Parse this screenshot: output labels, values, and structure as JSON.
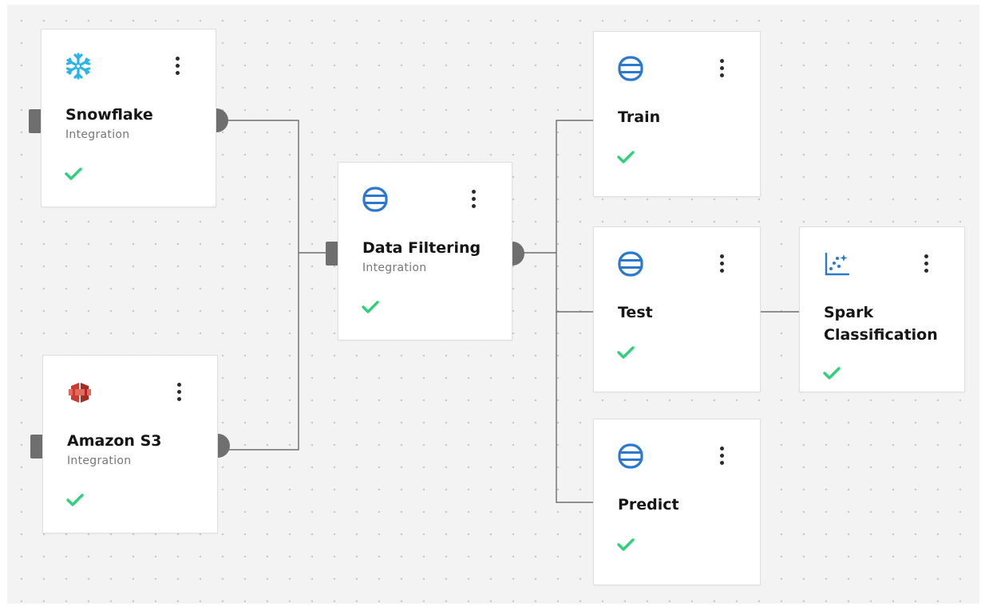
{
  "colors": {
    "canvas_background": "#f3f3f3",
    "grid_dot": "#c6c6c6",
    "edge": "#6f6f6f",
    "port": "#6f6f6f",
    "check": "#2ed17a",
    "database_icon": "#2b78d0",
    "snowflake_icon": "#29b5e8",
    "s3_icon": "#d0392f",
    "chart_icon": "#2b78d0"
  },
  "nodes": {
    "snowflake": {
      "title": "Snowflake",
      "subtitle": "Integration",
      "icon": "snowflake-icon",
      "status": "success"
    },
    "amazon_s3": {
      "title": "Amazon S3",
      "subtitle": "Integration",
      "icon": "amazon-s3-icon",
      "status": "success"
    },
    "data_filtering": {
      "title": "Data Filtering",
      "subtitle": "Integration",
      "icon": "database-icon",
      "status": "success"
    },
    "train": {
      "title": "Train",
      "icon": "database-icon",
      "status": "success"
    },
    "test": {
      "title": "Test",
      "icon": "database-icon",
      "status": "success"
    },
    "predict": {
      "title": "Predict",
      "icon": "database-icon",
      "status": "success"
    },
    "spark_classification": {
      "title": "Spark\nClassification",
      "icon": "scatter-chart-icon",
      "status": "success"
    }
  },
  "edges": [
    {
      "from": "snowflake",
      "to": "data_filtering"
    },
    {
      "from": "amazon_s3",
      "to": "data_filtering"
    },
    {
      "from": "data_filtering",
      "to": "train"
    },
    {
      "from": "data_filtering",
      "to": "test"
    },
    {
      "from": "data_filtering",
      "to": "predict"
    },
    {
      "from": "test",
      "to": "spark_classification"
    }
  ]
}
